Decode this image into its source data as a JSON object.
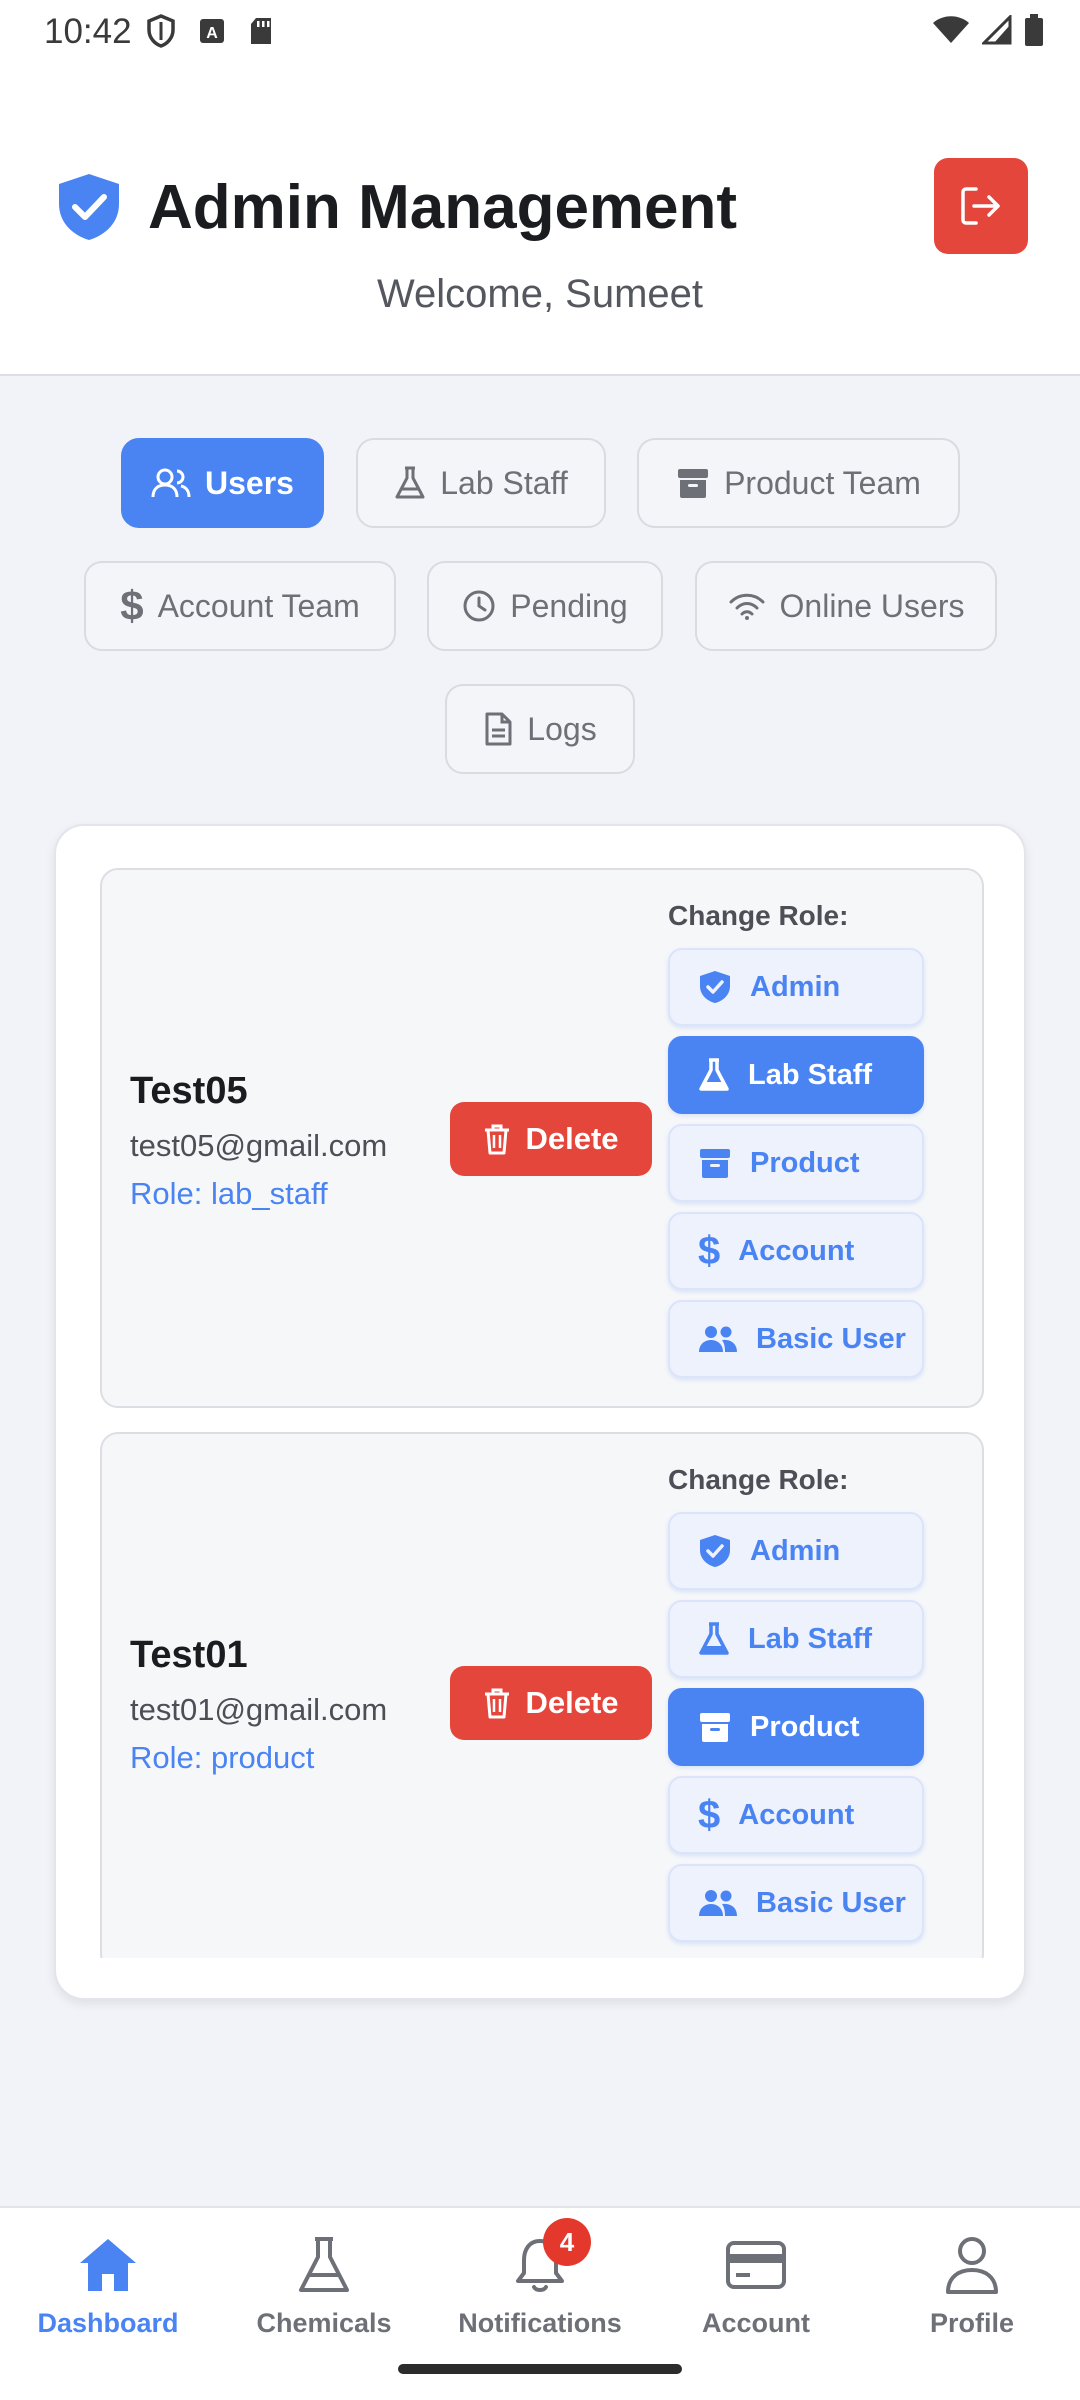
{
  "status_bar": {
    "time": "10:42"
  },
  "header": {
    "title": "Admin Management",
    "welcome": "Welcome, Sumeet"
  },
  "tabs": [
    {
      "label": "Users",
      "icon": "users-icon",
      "active": true
    },
    {
      "label": "Lab Staff",
      "icon": "flask-icon",
      "active": false
    },
    {
      "label": "Product Team",
      "icon": "archive-icon",
      "active": false
    },
    {
      "label": "Account Team",
      "icon": "dollar-icon",
      "active": false
    },
    {
      "label": "Pending",
      "icon": "clock-icon",
      "active": false
    },
    {
      "label": "Online Users",
      "icon": "wifi-icon",
      "active": false
    },
    {
      "label": "Logs",
      "icon": "file-icon",
      "active": false
    }
  ],
  "change_role_label": "Change Role:",
  "delete_label": "Delete",
  "role_options": [
    "Admin",
    "Lab Staff",
    "Product",
    "Account",
    "Basic User"
  ],
  "users": [
    {
      "name": "Test05",
      "email": "test05@gmail.com",
      "role": "Role: lab_staff",
      "active_role": "Lab Staff"
    },
    {
      "name": "Test01",
      "email": "test01@gmail.com",
      "role": "Role: product",
      "active_role": "Product"
    }
  ],
  "bottom_nav": [
    {
      "label": "Dashboard",
      "icon": "home-icon",
      "active": true
    },
    {
      "label": "Chemicals",
      "icon": "flask-icon",
      "active": false
    },
    {
      "label": "Notifications",
      "icon": "bell-icon",
      "active": false,
      "badge": "4"
    },
    {
      "label": "Account",
      "icon": "card-icon",
      "active": false
    },
    {
      "label": "Profile",
      "icon": "person-icon",
      "active": false
    }
  ],
  "colors": {
    "primary": "#4a84f3",
    "danger": "#e5463c",
    "background": "#f1f3f8"
  }
}
